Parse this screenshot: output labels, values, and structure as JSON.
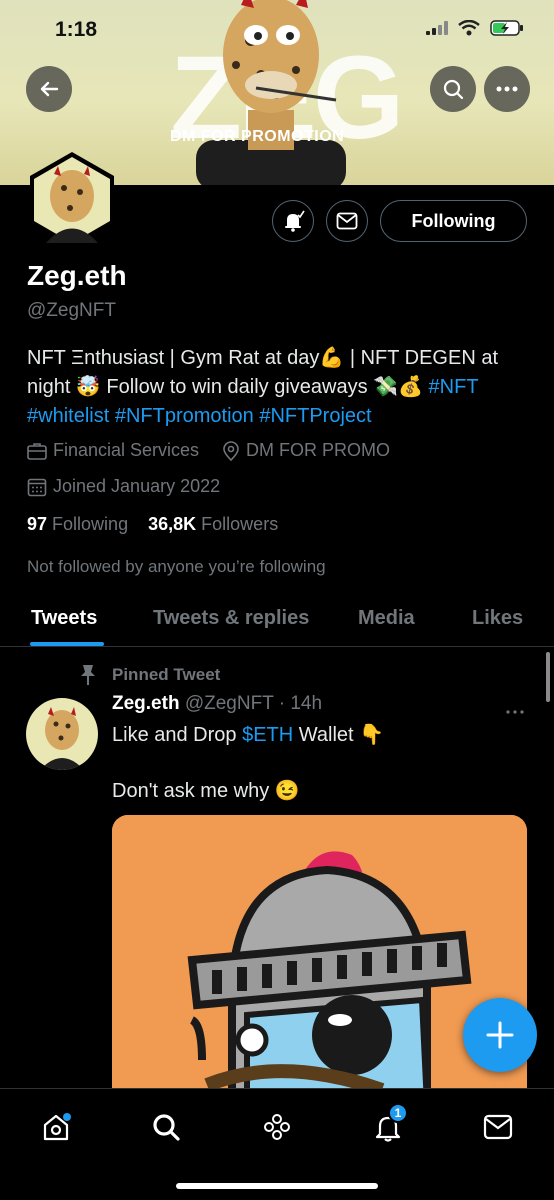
{
  "status_bar": {
    "time": "1:18"
  },
  "banner": {
    "word": "ZEG",
    "subtitle": "DM FOR PROMOTION"
  },
  "profile": {
    "name": "Zeg.eth",
    "handle": "@ZegNFT",
    "following_button": "Following",
    "bio": {
      "text": "NFT Ξnthusiast | Gym Rat at day💪 | NFT DEGEN at night 🤯 Follow to win daily giveaways 💸💰 ",
      "tags": [
        "#NFT",
        "#whitelist",
        "#NFTpromotion",
        "#NFTProject"
      ]
    },
    "category": "Financial Services",
    "location": "DM FOR PROMO",
    "joined": "Joined January 2022",
    "following_count": "97",
    "following_label": "Following",
    "followers_count": "36,8K",
    "followers_label": "Followers",
    "not_followed": "Not followed by anyone you’re following"
  },
  "tabs": [
    {
      "label": "Tweets",
      "active": true
    },
    {
      "label": "Tweets & replies",
      "active": false
    },
    {
      "label": "Media",
      "active": false
    },
    {
      "label": "Likes",
      "active": false
    }
  ],
  "tweet": {
    "pinned_label": "Pinned Tweet",
    "author_name": "Zeg.eth",
    "author_handle": "@ZegNFT",
    "time": "· 14h",
    "line1_prefix": "Like and Drop ",
    "line1_cashtag": "$ETH",
    "line1_suffix": " Wallet 👇",
    "line2": "Don't ask me why 😉"
  },
  "bottom_nav": {
    "items": [
      "home-icon",
      "search-icon",
      "spaces-icon",
      "notifications-icon",
      "messages-icon"
    ],
    "notification_badge": "1"
  },
  "colors": {
    "accent": "#1d9bf0",
    "background": "#000000",
    "muted": "#71767b"
  }
}
